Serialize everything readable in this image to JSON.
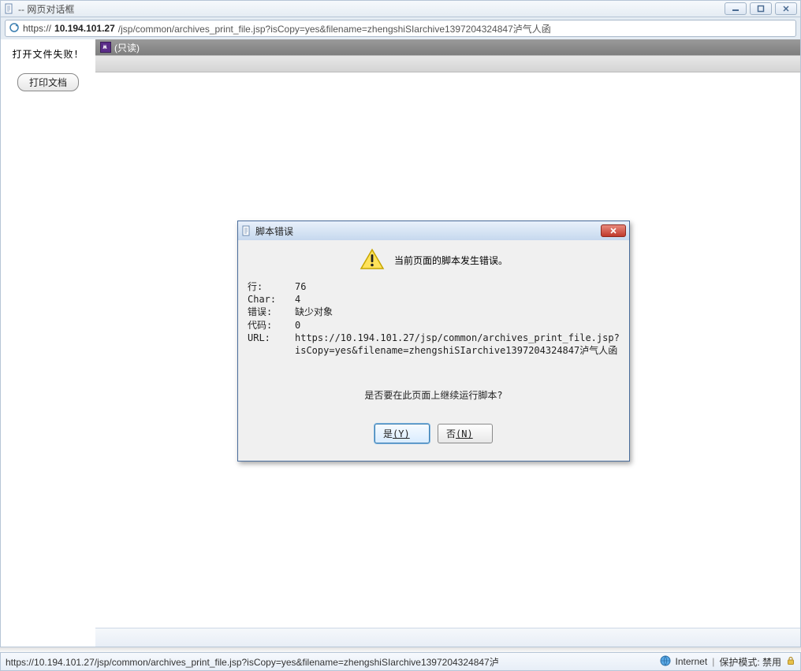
{
  "window": {
    "title": " -- 网页对话框"
  },
  "url": {
    "scheme": "https://",
    "host": "10.194.101.27",
    "rest": "/jsp/common/archives_print_file.jsp?isCopy=yes&filename=zhengshiSIarchive1397204324847泸气人函"
  },
  "left": {
    "fail_text": "打开文件失败！",
    "print_btn": "打印文档"
  },
  "viewer": {
    "readonly_label": "(只读)"
  },
  "dialog": {
    "title": "脚本错误",
    "message": "当前页面的脚本发生错误。",
    "rows": {
      "line_k": "行:",
      "line_v": "76",
      "char_k": "Char:",
      "char_v": "4",
      "err_k": "错误:",
      "err_v": "缺少对象",
      "code_k": "代码:",
      "code_v": "0",
      "url_k": "URL:",
      "url_v": "https://10.194.101.27/jsp/common/archives_print_file.jsp?isCopy=yes&filename=zhengshiSIarchive1397204324847泸气人函"
    },
    "question": "是否要在此页面上继续运行脚本?",
    "yes_label": "是",
    "yes_hot": "(Y)",
    "no_label": "否",
    "no_hot": "(N)"
  },
  "status": {
    "url": "https://10.194.101.27/jsp/common/archives_print_file.jsp?isCopy=yes&filename=zhengshiSIarchive1397204324847泸",
    "zone": "Internet",
    "protected": "保护模式: 禁用"
  }
}
